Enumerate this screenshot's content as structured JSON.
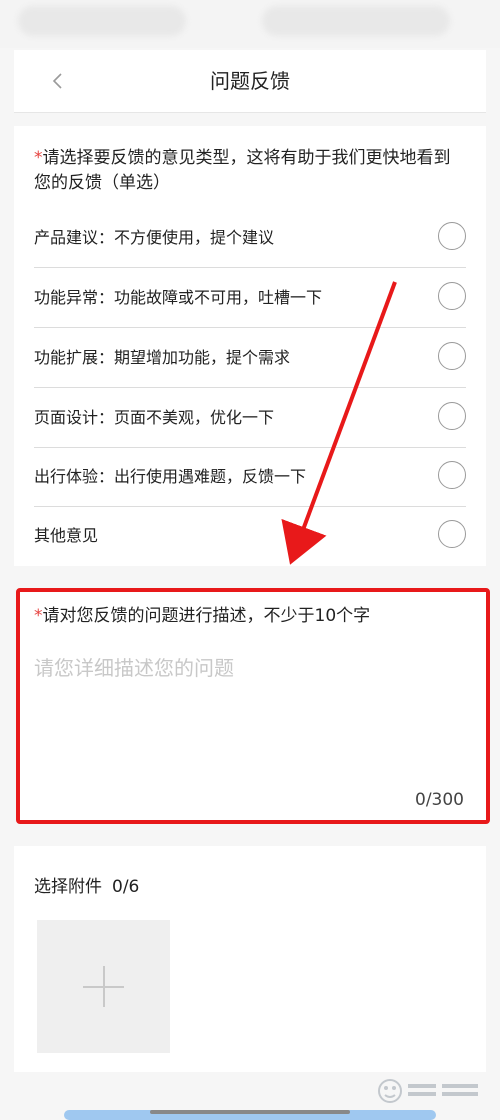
{
  "header": {
    "title": "问题反馈",
    "back_icon": "chevron-left-icon"
  },
  "type_section": {
    "required_mark": "*",
    "title": "请选择要反馈的意见类型，这将有助于我们更快地看到您的反馈（单选）",
    "options": [
      {
        "label": "产品建议：不方便使用，提个建议",
        "selected": false
      },
      {
        "label": "功能异常：功能故障或不可用，吐槽一下",
        "selected": false
      },
      {
        "label": "功能扩展：期望增加功能，提个需求",
        "selected": false
      },
      {
        "label": "页面设计：页面不美观，优化一下",
        "selected": false
      },
      {
        "label": "出行体验：出行使用遇难题，反馈一下",
        "selected": false
      },
      {
        "label": "其他意见",
        "selected": false
      }
    ]
  },
  "description": {
    "required_mark": "*",
    "title": "请对您反馈的问题进行描述，不少于10个字",
    "placeholder": "请您详细描述您的问题",
    "value": "",
    "counter": "0/300"
  },
  "attachments": {
    "title": "选择附件",
    "count": "0/6",
    "add_icon": "plus-icon"
  },
  "colors": {
    "required": "#e64340",
    "highlight_border": "#e8191a",
    "annotation_arrow": "#e8191a"
  },
  "watermark_icon": "baidu-jingyan-logo"
}
